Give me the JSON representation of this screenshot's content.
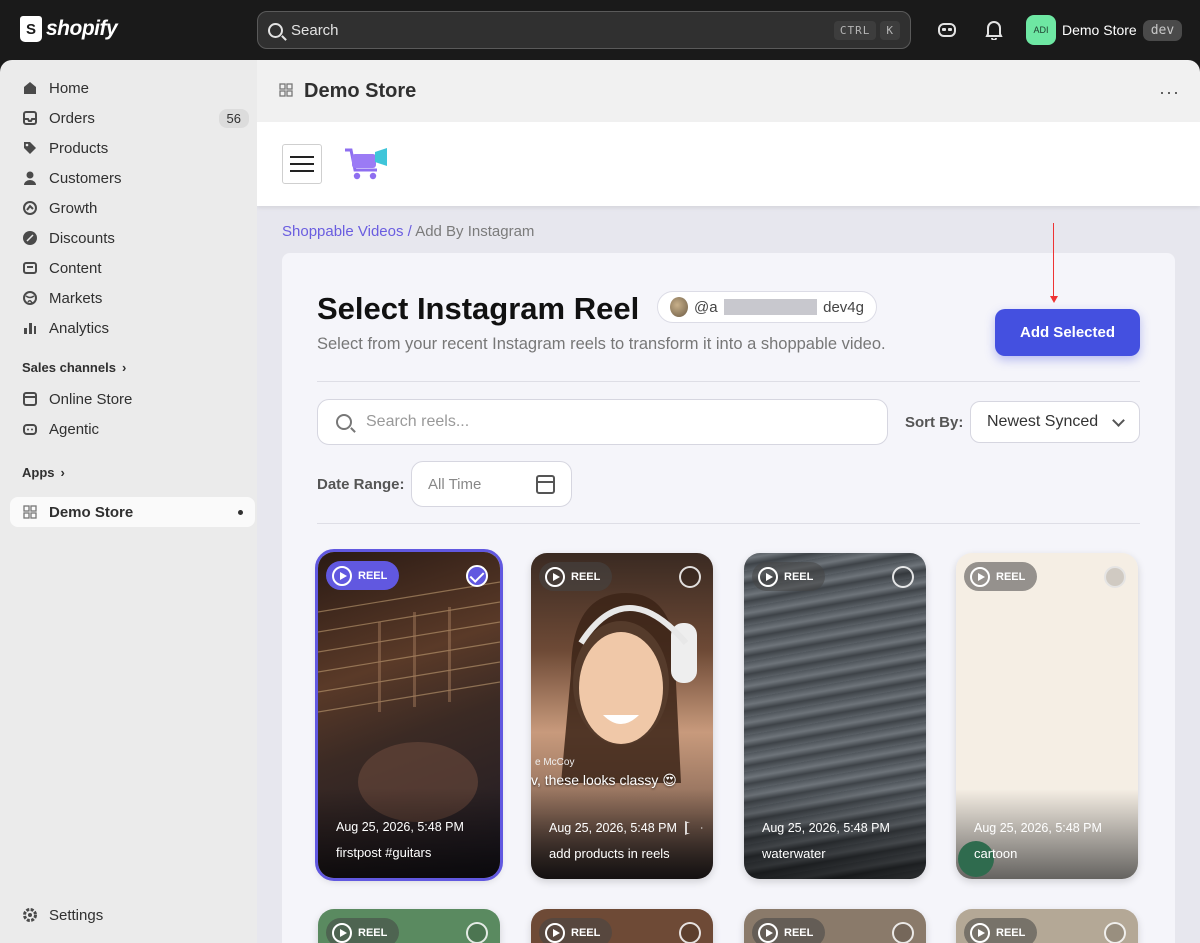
{
  "topbar": {
    "logo_text": "shopify",
    "search_placeholder": "Search",
    "shortcut_ctrl": "CTRL",
    "shortcut_key": "K",
    "store_initials": "ADI",
    "store_name": "Demo Store",
    "env_badge": "dev"
  },
  "sidebar": {
    "items": [
      {
        "label": "Home",
        "icon": "home-icon"
      },
      {
        "label": "Orders",
        "icon": "inbox-icon",
        "count": "56"
      },
      {
        "label": "Products",
        "icon": "tag-icon"
      },
      {
        "label": "Customers",
        "icon": "person-icon"
      },
      {
        "label": "Growth",
        "icon": "growth-icon"
      },
      {
        "label": "Discounts",
        "icon": "discount-icon"
      },
      {
        "label": "Content",
        "icon": "content-icon"
      },
      {
        "label": "Markets",
        "icon": "globe-icon"
      },
      {
        "label": "Analytics",
        "icon": "bar-chart-icon"
      }
    ],
    "sales_channels_label": "Sales channels",
    "channels": [
      {
        "label": "Online Store",
        "icon": "store-icon"
      },
      {
        "label": "Agentic",
        "icon": "agent-icon"
      }
    ],
    "apps_label": "Apps",
    "active_app": "Demo Store",
    "settings_label": "Settings"
  },
  "main": {
    "title": "Demo Store",
    "more": "···"
  },
  "app": {
    "breadcrumb_link": "Shoppable Videos /",
    "breadcrumb_current": "Add By Instagram",
    "page_title": "Select Instagram Reel",
    "account_prefix": "@a",
    "account_suffix": "dev4g",
    "subtitle": "Select from your recent Instagram reels to transform it into a shoppable video.",
    "add_button": "Add Selected",
    "search_placeholder": "Search reels...",
    "sort_label": "Sort By:",
    "sort_value": "Newest Synced",
    "date_label": "Date Range:",
    "date_value": "All Time",
    "accent_color": "#4450e0"
  },
  "reels": [
    {
      "badge": "REEL",
      "date": "Aug 25, 2026, 5:48 PM",
      "caption": "firstpost #guitars",
      "selected": true
    },
    {
      "badge": "REEL",
      "date": "Aug 25, 2026, 5:48 PM",
      "caption": "add products in reels",
      "selected": false,
      "overlay_name": "e McCoy",
      "overlay_quote": "v, these looks classy 😍"
    },
    {
      "badge": "REEL",
      "date": "Aug 25, 2026, 5:48 PM",
      "caption": "waterwater",
      "selected": false
    },
    {
      "badge": "REEL",
      "date": "Aug 25, 2026, 5:48 PM",
      "caption": "cartoon",
      "selected": false
    }
  ],
  "reels_row2": [
    {
      "badge": "REEL"
    },
    {
      "badge": "REEL"
    },
    {
      "badge": "REEL"
    },
    {
      "badge": "REEL"
    }
  ]
}
